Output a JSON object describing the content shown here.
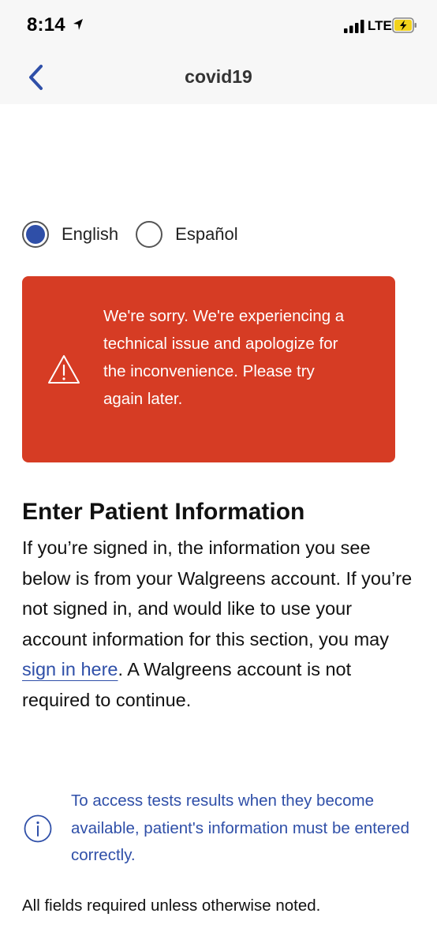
{
  "status_bar": {
    "time": "8:14",
    "network": "LTE",
    "location_icon": "location-arrow-icon",
    "signal_icon": "cellular-signal-icon",
    "battery_icon": "battery-charging-icon"
  },
  "nav": {
    "title": "covid19",
    "back_icon": "chevron-left-icon"
  },
  "language": {
    "options": [
      {
        "label": "English",
        "selected": true
      },
      {
        "label": "Español",
        "selected": false
      }
    ]
  },
  "alert": {
    "icon": "warning-icon",
    "message": "We're sorry. We're experiencing a technical issue and apologize for the inconvenience. Please try again later."
  },
  "patient_info": {
    "title": "Enter Patient Information",
    "body_before_link": "If you’re signed in, the information you see below is from your Walgreens account. If you’re not signed in, and would like to use your account information for this section, you may ",
    "link_text": "sign in here",
    "body_after_link": ". A Walgreens account is not required to continue."
  },
  "info": {
    "icon": "info-icon",
    "message": "To access tests results when they become available, patient's information must be entered correctly."
  },
  "footer_note": "All fields required unless otherwise noted.",
  "colors": {
    "accent_blue": "#2f4fa8",
    "alert_red": "#d63c24",
    "bar_background": "#f7f7f7"
  }
}
